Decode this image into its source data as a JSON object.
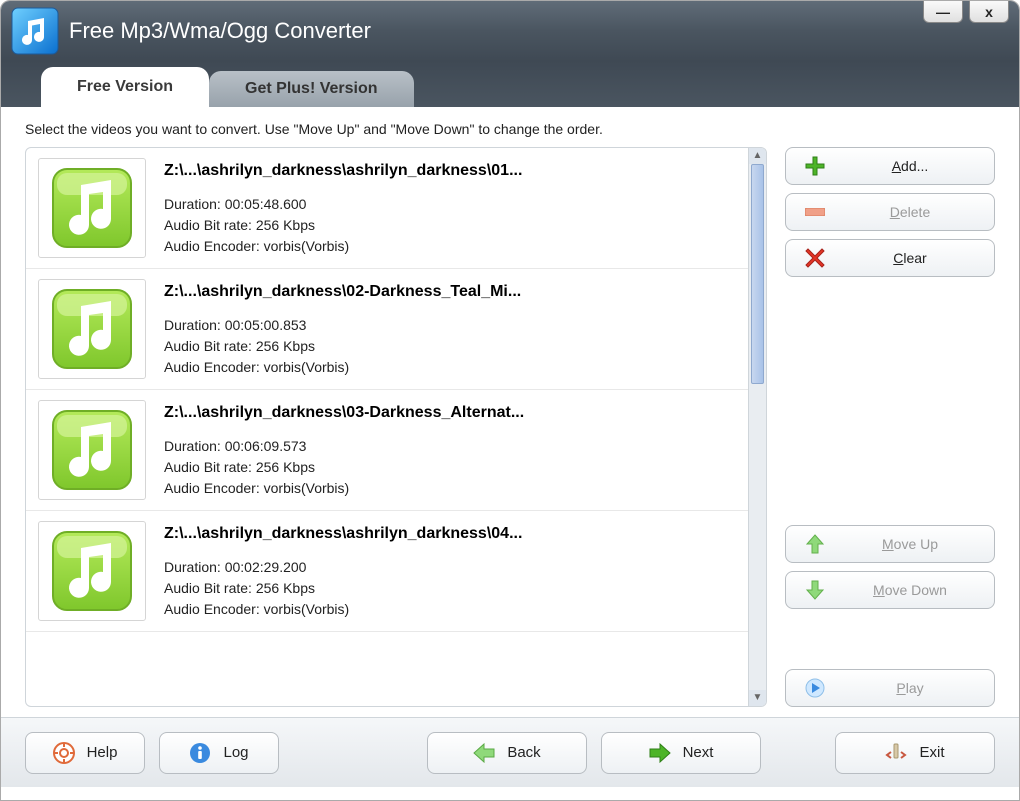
{
  "window": {
    "title": "Free Mp3/Wma/Ogg Converter"
  },
  "tabs": {
    "active": "Free Version",
    "inactive": "Get Plus! Version"
  },
  "instruction": "Select the videos you want to convert. Use \"Move Up\" and \"Move Down\" to change the order.",
  "items": [
    {
      "path": "Z:\\...\\ashrilyn_darkness\\ashrilyn_darkness\\01...",
      "duration": "Duration: 00:05:48.600",
      "bitrate": "Audio Bit rate: 256 Kbps",
      "encoder": "Audio Encoder: vorbis(Vorbis)"
    },
    {
      "path": "Z:\\...\\ashrilyn_darkness\\02-Darkness_Teal_Mi...",
      "duration": "Duration: 00:05:00.853",
      "bitrate": "Audio Bit rate: 256 Kbps",
      "encoder": "Audio Encoder: vorbis(Vorbis)"
    },
    {
      "path": "Z:\\...\\ashrilyn_darkness\\03-Darkness_Alternat...",
      "duration": "Duration: 00:06:09.573",
      "bitrate": "Audio Bit rate: 256 Kbps",
      "encoder": "Audio Encoder: vorbis(Vorbis)"
    },
    {
      "path": "Z:\\...\\ashrilyn_darkness\\ashrilyn_darkness\\04...",
      "duration": "Duration: 00:02:29.200",
      "bitrate": "Audio Bit rate: 256 Kbps",
      "encoder": "Audio Encoder: vorbis(Vorbis)"
    }
  ],
  "buttons": {
    "add": "Add...",
    "delete": "Delete",
    "clear": "Clear",
    "moveUp": "Move Up",
    "moveDown": "Move Down",
    "play": "Play",
    "help": "Help",
    "log": "Log",
    "back": "Back",
    "next": "Next",
    "exit": "Exit"
  }
}
